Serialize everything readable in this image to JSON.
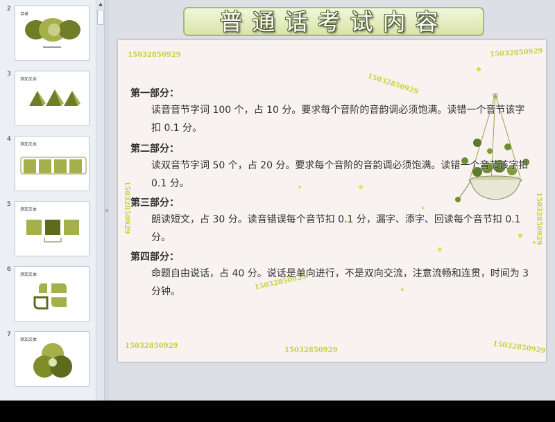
{
  "thumbnails": [
    {
      "number": "2",
      "title": "目录"
    },
    {
      "number": "3",
      "title": "添加文本"
    },
    {
      "number": "4",
      "title": "添加文本"
    },
    {
      "number": "5",
      "title": "添加文本"
    },
    {
      "number": "6",
      "title": "添加文本"
    },
    {
      "number": "7",
      "title": "添加文本"
    }
  ],
  "slide": {
    "title": "普通话考试内容",
    "watermark": "15032850929",
    "sections": [
      {
        "heading": "第一部分：",
        "body": "读音音节字词 100 个，占 10 分。要求每个音阶的音韵调必须饱满。读错一个音节该字扣 0.1 分。"
      },
      {
        "heading": "第二部分：",
        "body": "读双音节字词 50 个，占 20 分。要求每个音阶的音韵调必须饱满。读错一个音节该字扣 0.1 分。"
      },
      {
        "heading": "第三部分：",
        "body": "朗读短文，占 30 分。读音错误每个音节扣 0.1 分，漏字、添字、回读每个音节扣 0.1 分。"
      },
      {
        "heading": "第四部分：",
        "body": "命题自由说话，占 40 分。说话是单向进行，不是双向交流，注意流畅和连贯，时间为 3 分钟。"
      }
    ]
  },
  "colors": {
    "accent": "#7e8c2a",
    "watermark": "#c7d23c",
    "slide_bg": "#f8f3f1"
  }
}
